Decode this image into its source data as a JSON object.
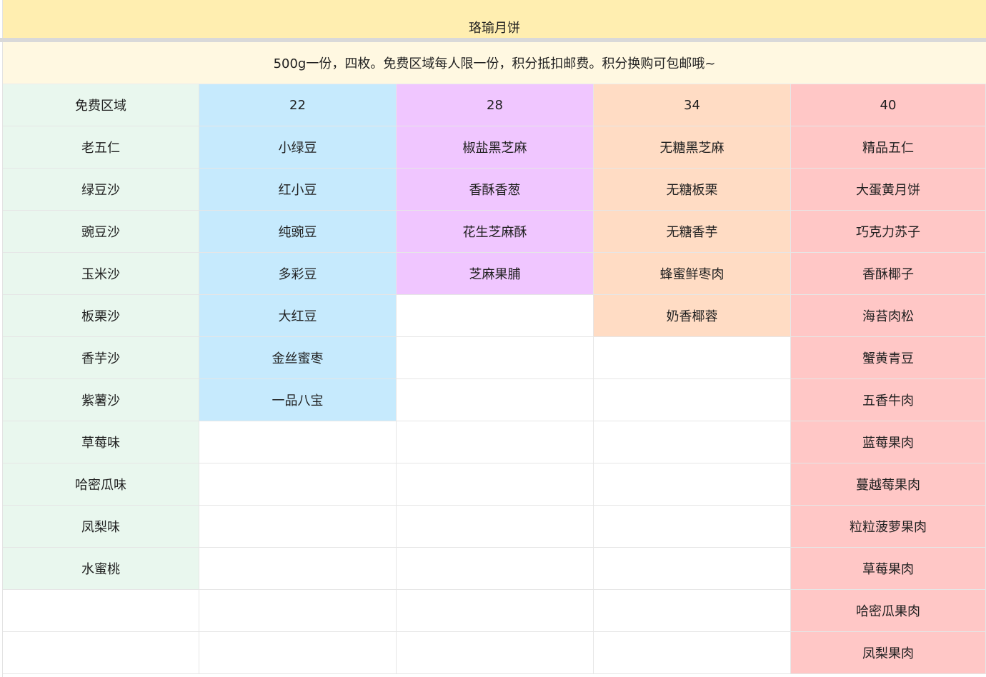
{
  "title": "珞瑜月饼",
  "note": "500g一份，四枚。免费区域每人限一份，积分抵扣邮费。积分换购可包邮哦~",
  "columns": [
    {
      "header": "免费区域",
      "items": [
        "老五仁",
        "绿豆沙",
        "豌豆沙",
        "玉米沙",
        "板栗沙",
        "香芋沙",
        "紫薯沙",
        "草莓味",
        "哈密瓜味",
        "凤梨味",
        "水蜜桃"
      ]
    },
    {
      "header": "22",
      "items": [
        "小绿豆",
        "红小豆",
        "纯豌豆",
        "多彩豆",
        "大红豆",
        "金丝蜜枣",
        "一品八宝"
      ]
    },
    {
      "header": "28",
      "items": [
        "椒盐黑芝麻",
        "香酥香葱",
        "花生芝麻酥",
        "芝麻果脯"
      ]
    },
    {
      "header": "34",
      "items": [
        "无糖黑芝麻",
        "无糖板栗",
        "无糖香芋",
        "蜂蜜鲜枣肉",
        "奶香椰蓉"
      ]
    },
    {
      "header": "40",
      "items": [
        "精品五仁",
        "大蛋黄月饼",
        "巧克力苏子",
        "香酥椰子",
        "海苔肉松",
        "蟹黄青豆",
        "五香牛肉",
        "蓝莓果肉",
        "蔓越莓果肉",
        "粒粒菠萝果肉",
        "草莓果肉",
        "哈密瓜果肉",
        "凤梨果肉"
      ]
    }
  ],
  "colors": {
    "title_bg": "#ffeeb0",
    "note_bg": "#fff8e1",
    "free_bg": "#e9f7ee",
    "price22_bg": "#c6eafd",
    "price28_bg": "#f0c6ff",
    "price34_bg": "#ffdcc4",
    "price40_bg": "#ffc7c6"
  }
}
